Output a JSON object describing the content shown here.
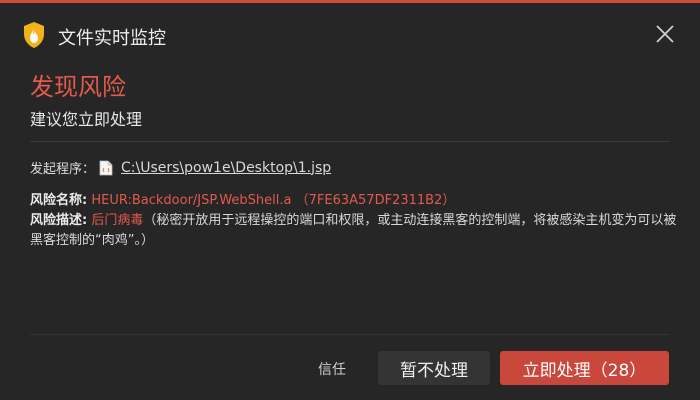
{
  "window": {
    "title": "文件实时监控"
  },
  "alert": {
    "headline": "发现风险",
    "subheadline": "建议您立即处理"
  },
  "source": {
    "label": "发起程序：",
    "path": "C:\\Users\\pow1e\\Desktop\\1.jsp"
  },
  "risk": {
    "name_label": "风险名称:",
    "name_value": "HEUR:Backdoor/JSP.WebShell.a （7FE63A57DF2311B2）",
    "desc_label": "风险描述:",
    "desc_type": "后门病毒",
    "desc_text": "（秘密开放用于远程操控的端口和权限，或主动连接黑客的控制端，将被感染主机变为可以被黑客控制的“肉鸡”。）"
  },
  "actions": {
    "trust": "信任",
    "later": "暂不处理",
    "handle_now": "立即处理（28）"
  },
  "colors": {
    "accent": "#cc4b3a",
    "danger_text": "#e25a4b",
    "background": "#262626",
    "secondary_button": "#343434"
  },
  "icons": {
    "logo": "shield-flame-icon",
    "close": "close-icon",
    "file": "jsp-file-icon"
  }
}
